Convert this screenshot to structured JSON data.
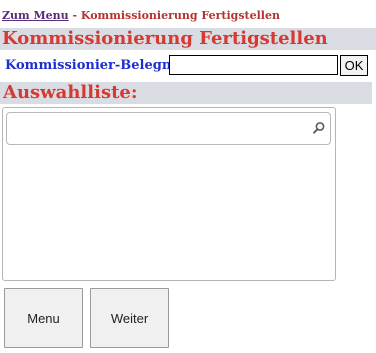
{
  "breadcrumb": {
    "link_label": "Zum Menu",
    "separator": " - ",
    "current": "Kommissionierung Fertigstellen"
  },
  "page_title": "Kommissionierung Fertigstellen",
  "form": {
    "field_label": "Kommissionier-Belegnr:",
    "field_value": "",
    "ok_label": "OK"
  },
  "selection": {
    "heading": "Auswahlliste:",
    "search_value": ""
  },
  "buttons": {
    "menu_label": "Menu",
    "next_label": "Weiter"
  },
  "colors": {
    "heading_red": "#d43a32",
    "label_blue": "#1c2fd0",
    "bar_gray": "#dadce3",
    "link_purple": "#5a2d7a"
  },
  "icons": {
    "search": "search-icon"
  }
}
